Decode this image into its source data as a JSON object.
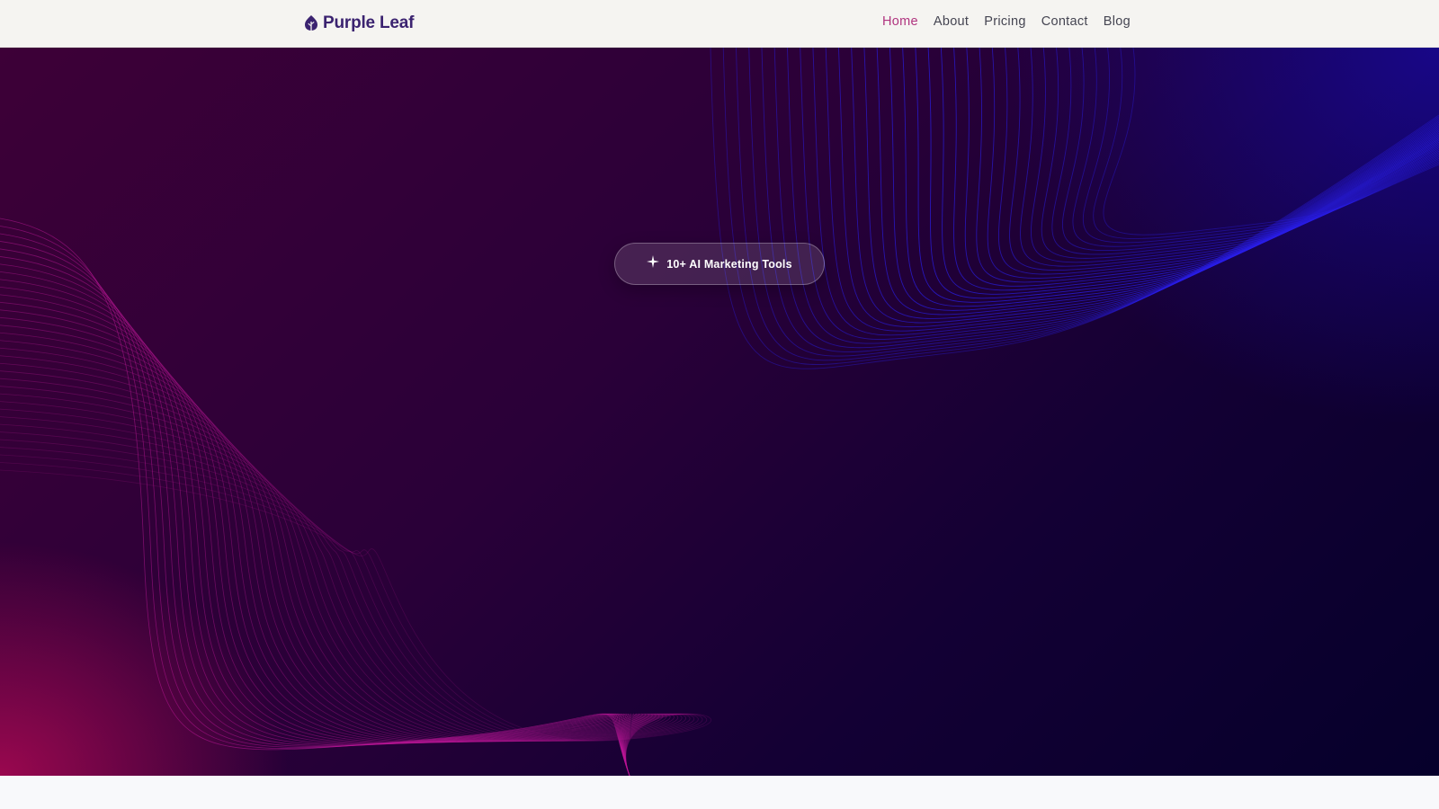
{
  "brand": {
    "name": "Purple Leaf",
    "icon": "leaf-icon",
    "color": "#3b2370"
  },
  "nav": {
    "items": [
      {
        "label": "Home",
        "active": true
      },
      {
        "label": "About",
        "active": false
      },
      {
        "label": "Pricing",
        "active": false
      },
      {
        "label": "Contact",
        "active": false
      },
      {
        "label": "Blog",
        "active": false
      }
    ],
    "active_color": "#b0347f",
    "text_color": "#454552"
  },
  "hero": {
    "badge": {
      "icon": "sparkle-icon",
      "label": "10+ AI Marketing Tools"
    },
    "colors": {
      "background_top_left": "#3d0037",
      "background_bottom_right": "#06002b",
      "pink_glow": "#a00850",
      "blue_accent": "#2a1ee8",
      "pink_lines": "#c0189a"
    }
  }
}
